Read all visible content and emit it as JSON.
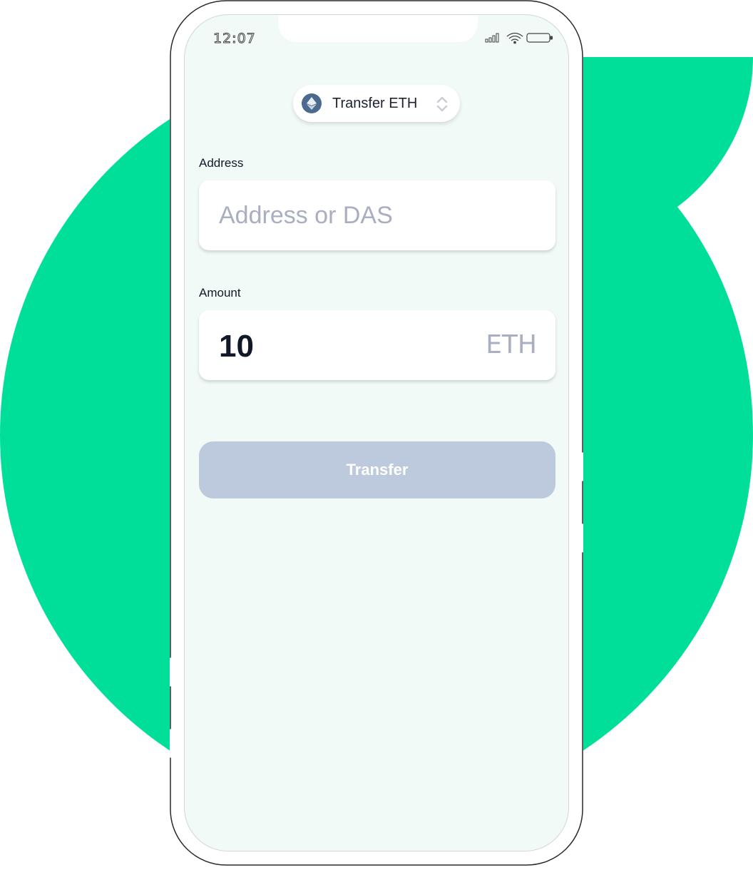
{
  "colors": {
    "accent_green": "#00df9a",
    "screen_background": "#f1faf6",
    "button_disabled": "#bdc9dd",
    "placeholder_gray": "#a9aec0",
    "eth_icon": "#4a6a8f"
  },
  "status_bar": {
    "time": "12:07",
    "icons": [
      "cellular-signal-icon",
      "wifi-icon",
      "battery-icon"
    ]
  },
  "token_selector": {
    "icon": "ethereum-icon",
    "label": "Transfer ETH",
    "chevron_icon": "sort-updown-icon"
  },
  "address": {
    "label": "Address",
    "value": "",
    "placeholder": "Address or DAS"
  },
  "amount": {
    "label": "Amount",
    "value": "10",
    "unit": "ETH"
  },
  "transfer_button": {
    "label": "Transfer",
    "state": "disabled"
  }
}
